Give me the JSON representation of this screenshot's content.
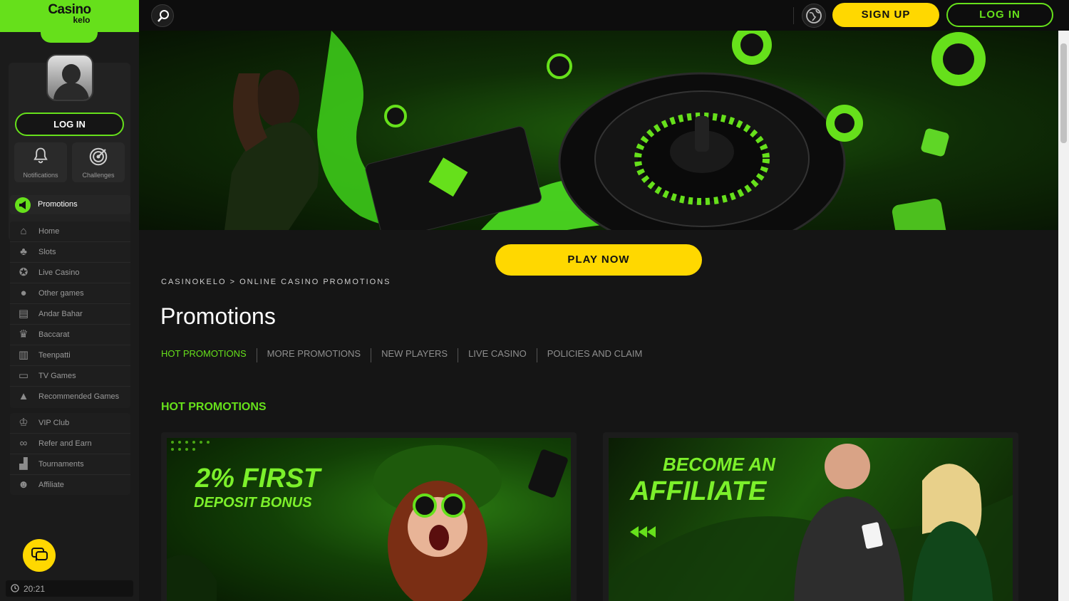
{
  "brand": {
    "logo_line1": "Casino",
    "logo_line2": "kelo"
  },
  "sidebar": {
    "login_label": "LOG IN",
    "quick": [
      {
        "label": "Notifications",
        "icon": "bell-icon"
      },
      {
        "label": "Challenges",
        "icon": "target-icon"
      }
    ],
    "promotions_label": "Promotions",
    "group1": [
      {
        "label": "Home",
        "icon": "home-icon"
      },
      {
        "label": "Slots",
        "icon": "cherries-icon"
      },
      {
        "label": "Live Casino",
        "icon": "chip-icon"
      },
      {
        "label": "Other games",
        "icon": "dots-icon"
      },
      {
        "label": "Andar Bahar",
        "icon": "card-icon"
      },
      {
        "label": "Baccarat",
        "icon": "baccarat-icon"
      },
      {
        "label": "Teenpatti",
        "icon": "teenpatti-icon"
      },
      {
        "label": "TV Games",
        "icon": "tv-icon"
      },
      {
        "label": "Recommended Games",
        "icon": "thumbs-up-icon"
      }
    ],
    "group2": [
      {
        "label": "VIP Club",
        "icon": "crown-icon"
      },
      {
        "label": "Refer and Earn",
        "icon": "link-icon"
      },
      {
        "label": "Tournaments",
        "icon": "podium-icon"
      },
      {
        "label": "Affiliate",
        "icon": "users-icon"
      }
    ],
    "clock": "20:21"
  },
  "topbar": {
    "signup_label": "SIGN UP",
    "login_label": "LOG IN"
  },
  "main": {
    "play_now_label": "PLAY NOW",
    "breadcrumb": {
      "home": "CASINOKELO",
      "separator": ">",
      "current": "ONLINE CASINO PROMOTIONS"
    },
    "title": "Promotions",
    "tabs": [
      "HOT PROMOTIONS",
      "MORE PROMOTIONS",
      "NEW PLAYERS",
      "LIVE CASINO",
      "POLICIES AND CLAIM"
    ],
    "section_title": "HOT PROMOTIONS",
    "cards": [
      {
        "line1": "2% FIRST",
        "line2": "DEPOSIT BONUS"
      },
      {
        "line1": "BECOME AN",
        "line2": "AFFILIATE"
      }
    ]
  },
  "colors": {
    "accent": "#66e01b",
    "cta": "#ffd800",
    "bg": "#151515",
    "sidebar": "#1b1b1b"
  }
}
